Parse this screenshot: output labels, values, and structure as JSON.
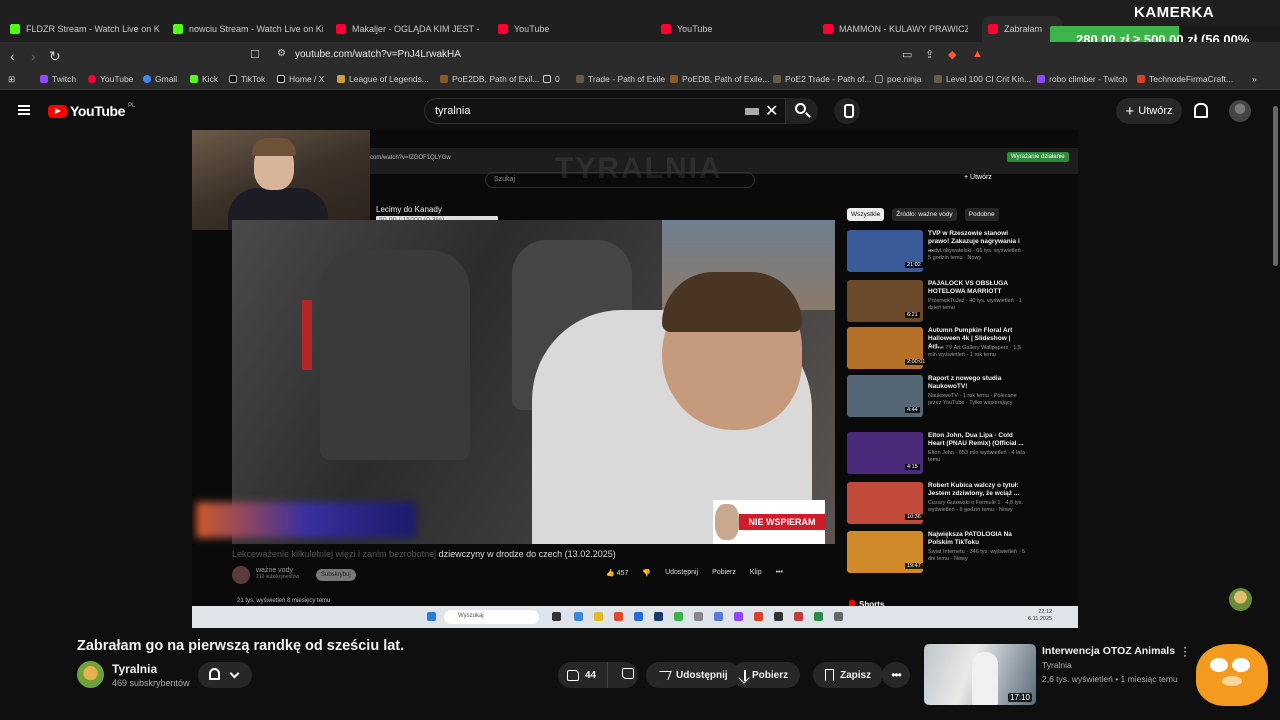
{
  "overlay": {
    "kamerka_label": "KAMERKA",
    "goal_text": "280,00 zł ≥ 500,00 zł (56.00%",
    "goal_progress": 0.56
  },
  "tabs": [
    {
      "label": "FLDZR Stream - Watch Live on Kick",
      "icon": "kick-icon"
    },
    {
      "label": "nowciu Stream - Watch Live on Kick",
      "icon": "kick-icon"
    },
    {
      "label": "Makaljer - OGLĄDA KIM JEST - YouT",
      "icon": "youtube-icon"
    },
    {
      "label": "YouTube",
      "icon": "youtube-icon"
    },
    {
      "label": "YouTube",
      "icon": "youtube-icon"
    },
    {
      "label": "MAMMON - KULAWY PRAWICZEK D",
      "icon": "youtube-icon"
    },
    {
      "label": "Zabrałam",
      "icon": "youtube-icon"
    }
  ],
  "addressbar": {
    "url": "youtube.com/watch?v=PnJ4LrwakHA"
  },
  "bookmarks": [
    {
      "label": "Twitch"
    },
    {
      "label": "YouTube"
    },
    {
      "label": "Gmail"
    },
    {
      "label": "Kick"
    },
    {
      "label": "TikTok"
    },
    {
      "label": "Home / X"
    },
    {
      "label": "League of Legends..."
    },
    {
      "label": "PoE2DB, Path of Exil..."
    },
    {
      "label": "0"
    },
    {
      "label": "Trade - Path of Exile"
    },
    {
      "label": "PoEDB, Path of Exile..."
    },
    {
      "label": "PoE2 Trade - Path of..."
    },
    {
      "label": "poe.ninja"
    },
    {
      "label": "Level 100 CI Crit Kin..."
    },
    {
      "label": "robo climber - Twitch"
    },
    {
      "label": "TechnodeFirmaCraft..."
    }
  ],
  "header": {
    "logo_text": "YouTube",
    "region": "PL",
    "search_value": "tyralnia",
    "create_label": "Utwórz"
  },
  "player": {
    "inner_url": "com/watch?v=fZGOF1QLYGw",
    "inner_title_watermark": "TYRALNIA",
    "inner_button": "Wyrażanie działanie",
    "inner_search_placeholder": "Szukaj",
    "inner_create": "+ Utwórz",
    "stream_goal_label": "Lecimy do Kanady",
    "stream_goal_value": "50,00 / 15000 (0,3%)",
    "badge_text": "NIE WSPIERAM",
    "inner_video_title_faded": "Lekceważenie kilkuletniej więzi i zanim bezrobotnej",
    "inner_video_title": "dziewczyny w drodze do czech (13.02.2025)",
    "inner_channel": "ważne vody",
    "inner_channel_subs": "212 subskrybentów",
    "inner_subscribe": "Subskrybuj",
    "inner_likes": "457",
    "inner_share": "Udostępnij",
    "inner_download": "Pobierz",
    "inner_clip": "Klip",
    "inner_views": "21 tys. wyświetleń  8 miesięcy temu",
    "inner_chips": [
      "Wszystkie",
      "Źródło: ważne vody",
      "Podobne"
    ],
    "inner_shorts": "Shorts",
    "taskbar_search": "Wyszukaj",
    "taskbar_time": "22:12",
    "taskbar_date": "6.11.2025",
    "recommendations": [
      {
        "title": "TVP w Rzeszowie stanowi prawo! Zakazuje nagrywania i ...",
        "meta": "audyt obywatelski · 66 tys. wyświetleń · 5 godzin temu · Nowy",
        "duration": "21:02",
        "color": "#3b5a9a"
      },
      {
        "title": "PAJALOCK VS OBSŁUGA HOTELOWA MARRIOTT",
        "meta": "PrzemekTuJaź · 40 tys. wyświetleń · 1 dzień temu",
        "duration": "6:21",
        "color": "#6a4a2a"
      },
      {
        "title": "Autumn Pumpkin Floral Art Halloween 4k | Slideshow | Art...",
        "meta": "Frame TV Art Gallery Wallpapers · 1,5 mln wyświetleń · 1 rok temu",
        "duration": "2:00:01",
        "color": "#b5702a"
      },
      {
        "title": "Raport z nowego studia NaukowoTV!",
        "meta": "NaukowoTV · 1 rok temu · Polecane przez YouTube · Tylko wspierający",
        "duration": "4:44",
        "color": "#556677"
      },
      {
        "title": "Elton John, Dua Lipa - Cold Heart (PNAU Remix) (Official ...",
        "meta": "Elton John · 653 mln wyświetleń · 4 lata temu",
        "duration": "4:15",
        "color": "#4a2a7a"
      },
      {
        "title": "Robert Kubica walczy o tytuł: Jestem zdziwiony, że wciąż ...",
        "meta": "Cezary Gutowski o Formule 1 · 4,8 tys. wyświetleń · 6 godzin temu · Nowy",
        "duration": "10:36",
        "color": "#c24a3a"
      },
      {
        "title": "Największa PATOLOGIA Na Polskim TikToku",
        "meta": "Świat Internetu · 346 tys. wyświetleń · 5 dni temu · Nowy",
        "duration": "19:47",
        "color": "#d08a2a"
      }
    ]
  },
  "video": {
    "title": "Zabrałam go na pierwszą randkę od sześciu lat.",
    "channel": "Tyralnia",
    "subscribers": "469 subskrybentów",
    "likes": "44",
    "share_label": "Udostępnij",
    "download_label": "Pobierz",
    "save_label": "Zapisz",
    "more_label": "•••"
  },
  "related": {
    "title": "Interwencja OTOZ Animals",
    "channel": "Tyralnia",
    "meta": "2,6 tys. wyświetleń • 1 miesiąc temu",
    "duration": "17:10"
  }
}
